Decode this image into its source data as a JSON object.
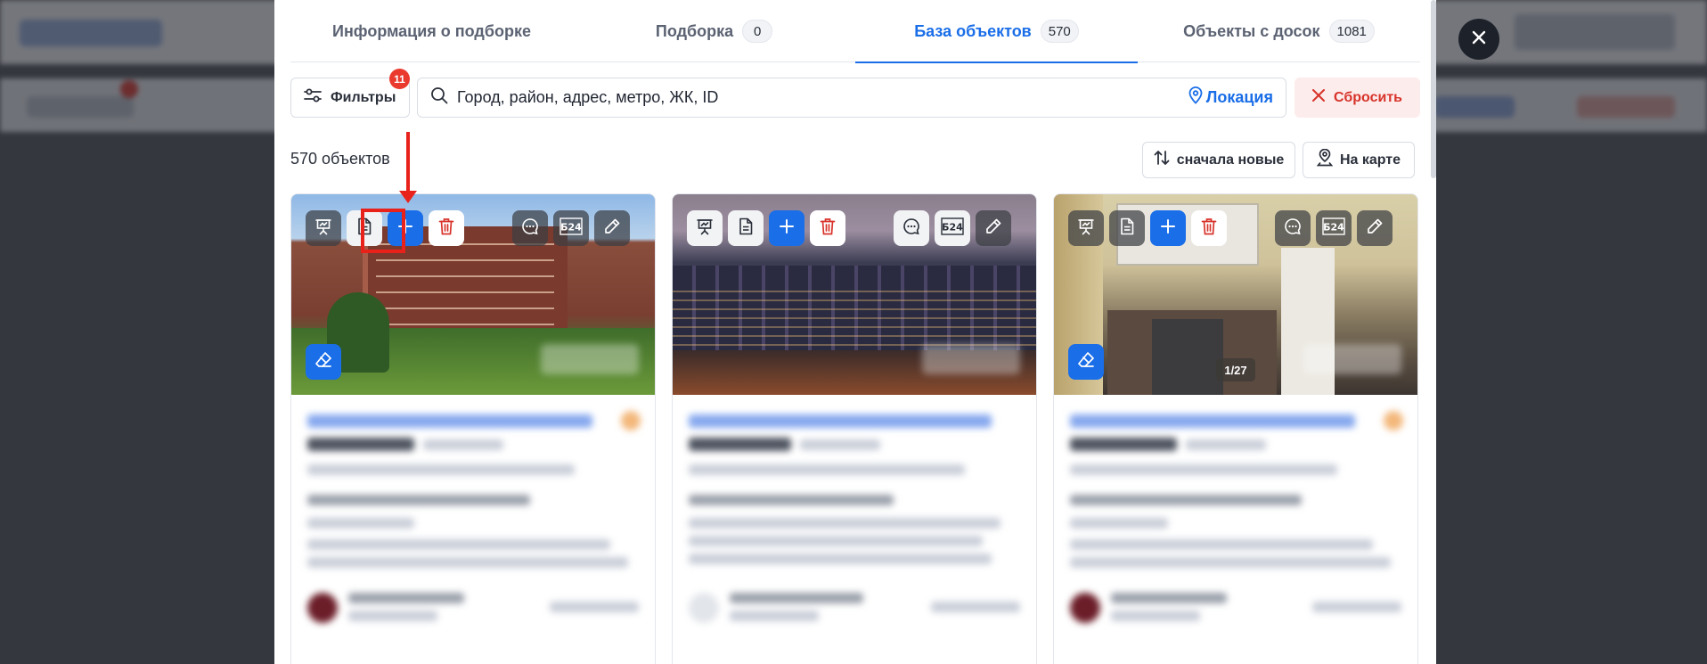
{
  "tabs": [
    {
      "label": "Информация о подборке",
      "count": null,
      "active": false
    },
    {
      "label": "Подборка",
      "count": "0",
      "active": false
    },
    {
      "label": "База объектов",
      "count": "570",
      "active": true
    },
    {
      "label": "Объекты с досок",
      "count": "1081",
      "active": false
    }
  ],
  "toolbar": {
    "filters_label": "Фильтры",
    "filters_count": "11",
    "search_text": "Город, район, адрес, метро, ЖК, ID",
    "location_label": "Локация",
    "reset_label": "Сбросить"
  },
  "results": {
    "count_label": "570 объектов",
    "sort_label": "сначала новые",
    "map_label": "На карте"
  },
  "cards": [
    {
      "photo_counter": null,
      "avatar": "photo"
    },
    {
      "photo_counter": null,
      "avatar": "placeholder"
    },
    {
      "photo_counter": "1/27",
      "avatar": "photo"
    }
  ],
  "card_actions": [
    "presentation-icon",
    "document-icon",
    "plus-icon",
    "trash-icon",
    "comment-icon",
    "b24-icon",
    "pencil-icon"
  ],
  "card_b24_label": "Б24",
  "colors": {
    "accent": "#1a6ee8",
    "danger": "#d7332a",
    "annotation": "#e8221b"
  }
}
